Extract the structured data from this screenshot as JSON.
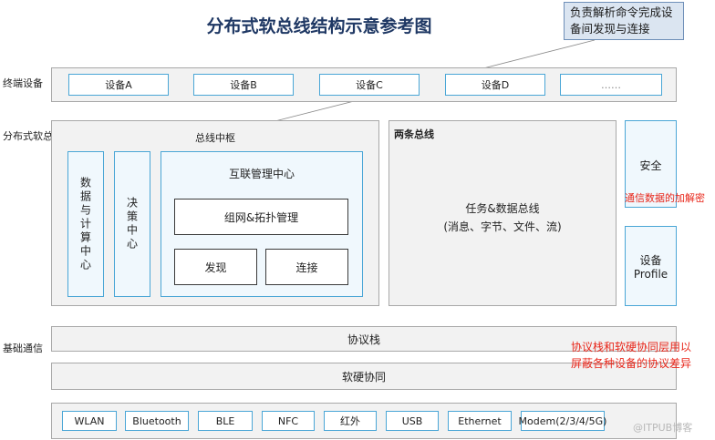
{
  "title": "分布式软总线结构示意参考图",
  "callout": "负责解析命令完成设备间发现与连接",
  "terminal": {
    "label": "终端设备",
    "devices": [
      "设备A",
      "设备B",
      "设备C",
      "设备D",
      "……"
    ]
  },
  "soft_bus": {
    "label": "分布式软总线",
    "hub": {
      "title": "总线中枢",
      "data_compute": "数据与计算中心",
      "decision": "决策中心",
      "interconnect": {
        "title": "互联管理中心",
        "networking": "组网&拓扑管理",
        "discovery": "发现",
        "connection": "连接"
      }
    },
    "two_buses": {
      "title": "两条总线",
      "line1": "任务&数据总线",
      "line2": "(消息、字节、文件、流)"
    },
    "security": "安全",
    "security_note": "通信数据的加解密",
    "device_profile_1": "设备",
    "device_profile_2": "Profile"
  },
  "base": {
    "label": "基础通信",
    "protocol_stack": "协议栈",
    "hw_sw": "软硬协同",
    "note_line1": "协议栈和软硬协同层用以",
    "note_line2": "屏蔽各种设备的协议差异",
    "techs": [
      "WLAN",
      "Bluetooth",
      "BLE",
      "NFC",
      "红外",
      "USB",
      "Ethernet",
      "Modem(2/3/4/5G)"
    ]
  },
  "watermark": "@ITPUB博客",
  "colors": {
    "title": "#1f3864",
    "cell_border": "#4aa6d6",
    "note_red": "#e8261a",
    "callout_bg": "#dbe5f1"
  }
}
